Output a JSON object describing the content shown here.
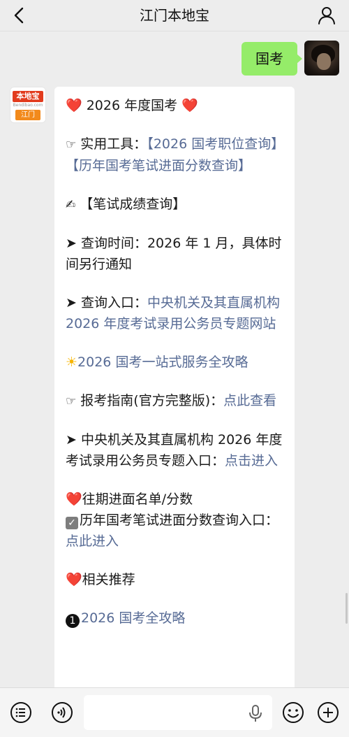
{
  "header": {
    "title": "江门本地宝",
    "back_icon": "chevron-left-icon",
    "profile_icon": "person-icon"
  },
  "outgoing": {
    "text": "国考"
  },
  "account_avatar": {
    "logo_name": "本地宝",
    "logo_url": "Bendibao.com",
    "logo_city": "江门"
  },
  "message": {
    "title": "2026 年度国考",
    "tools_prefix": "实用工具：",
    "tools_link1": "【2026 国考职位查询】",
    "tools_link2": "【历年国考笔试进面分数查询】",
    "score_heading": "【笔试成绩查询】",
    "query_time": "查询时间：2026 年 1 月，具体时间另行通知",
    "query_entry_prefix": "查询入口：",
    "query_entry_link": "中央机关及其直属机构 2026 年度考试录用公务员专题网站",
    "strategy_link": "2026 国考一站式服务全攻略",
    "guide_prefix": "报考指南(官方完整版)：",
    "guide_link": "点此查看",
    "portal_prefix": "中央机关及其直属机构 2026 年度考试录用公务员专题入口：",
    "portal_link": "点击进入",
    "past_heading": "往期进面名单/分数",
    "past_item_prefix": "历年国考笔试进面分数查询入口：",
    "past_item_link": "点此进入",
    "related_heading": "相关推荐",
    "related_item_number": "1",
    "related_item": "2026 国考全攻略"
  },
  "input_bar": {
    "voice_icon": "voice-icon",
    "menu_icon": "menu-list-icon",
    "mic_icon": "microphone-icon",
    "emoji_icon": "emoji-icon",
    "plus_icon": "plus-icon",
    "placeholder": ""
  },
  "colors": {
    "background": "#ededed",
    "outgoing_bubble": "#95ec69",
    "link": "#576b95",
    "heart": "#e5322d"
  }
}
